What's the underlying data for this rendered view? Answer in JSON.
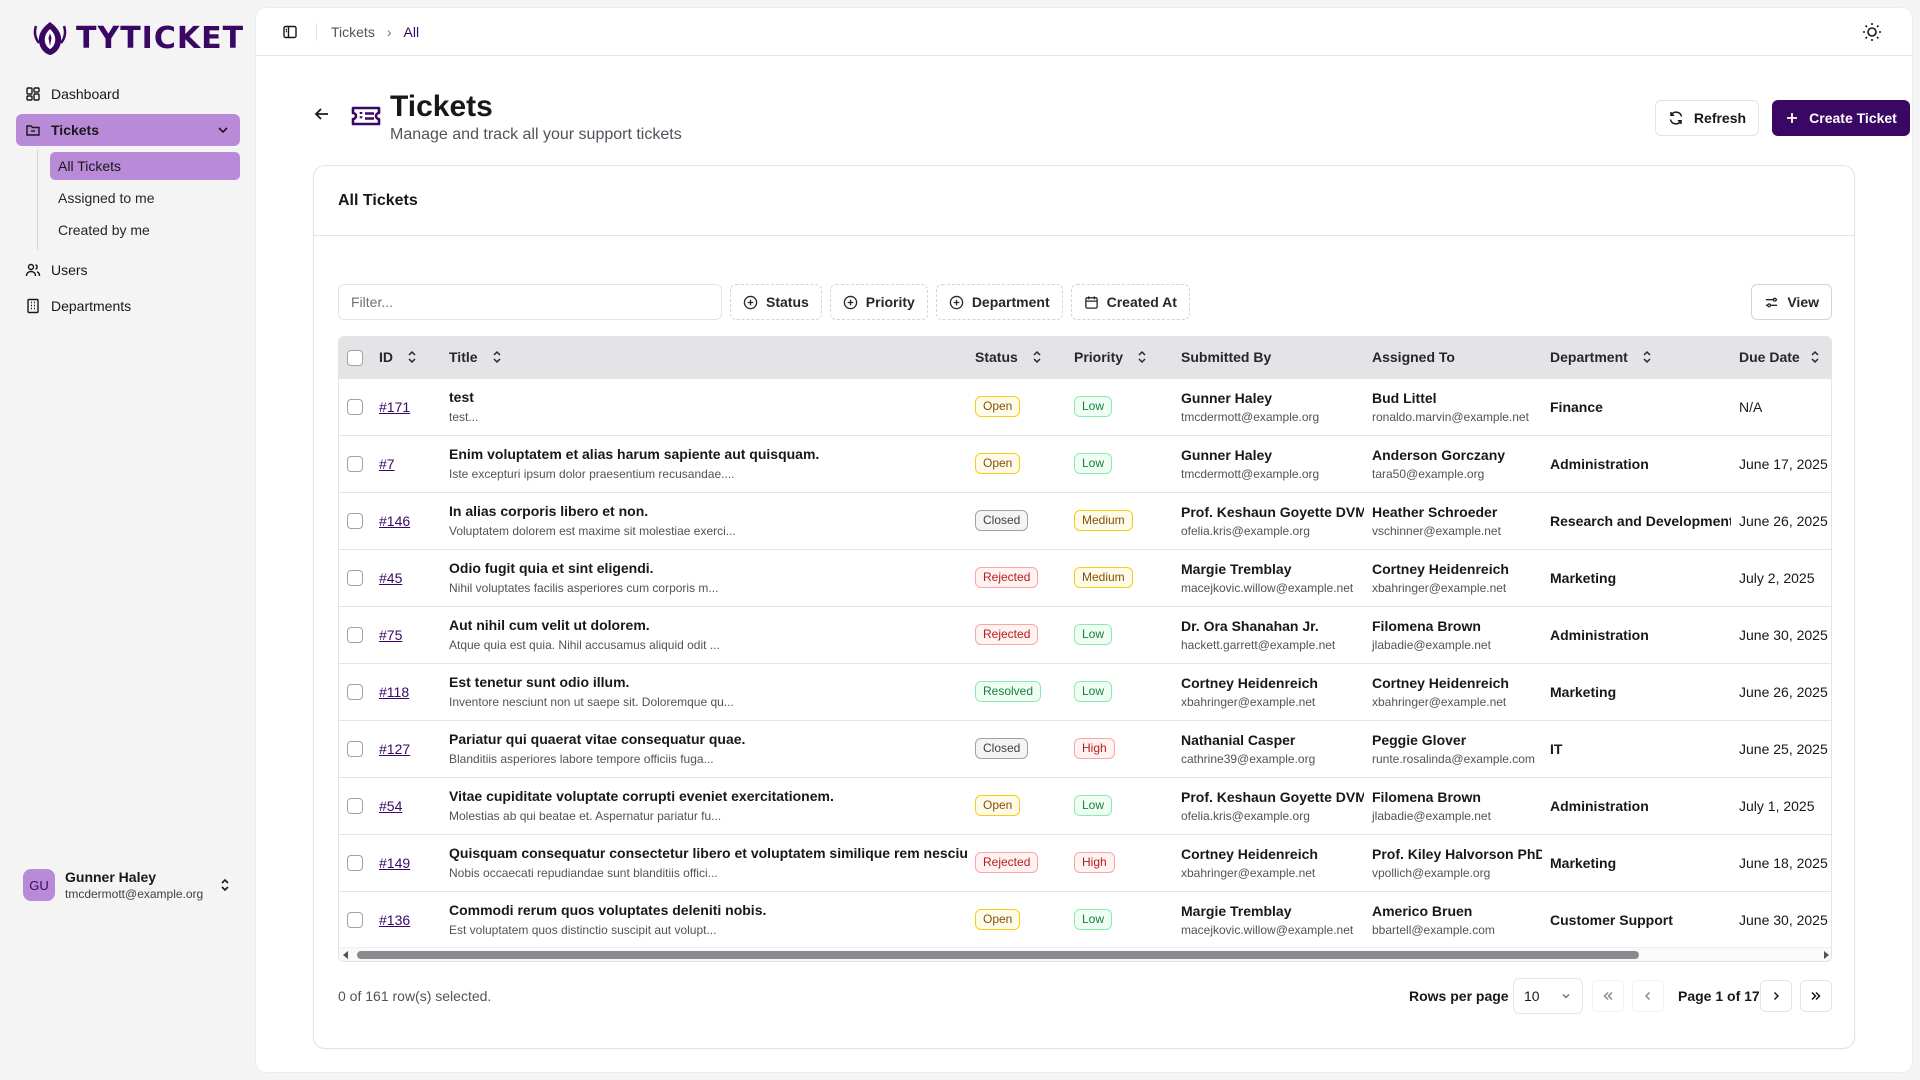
{
  "brand": {
    "name": "TYTICKET",
    "color": "#3b0764"
  },
  "sidebar": {
    "items": [
      {
        "label": "Dashboard",
        "icon": "dashboard-icon"
      },
      {
        "label": "Tickets",
        "icon": "ticket-folder-icon"
      },
      {
        "label": "Users",
        "icon": "users-icon"
      },
      {
        "label": "Departments",
        "icon": "building-icon"
      }
    ],
    "tickets_sub": [
      {
        "label": "All Tickets"
      },
      {
        "label": "Assigned to me"
      },
      {
        "label": "Created by me"
      }
    ],
    "user": {
      "initials": "GU",
      "name": "Gunner Haley",
      "email": "tmcdermott@example.org"
    }
  },
  "breadcrumb": {
    "root": "Tickets",
    "current": "All"
  },
  "header": {
    "title": "Tickets",
    "subtitle": "Manage and track all your support tickets",
    "refresh_label": "Refresh",
    "create_label": "Create Ticket"
  },
  "card": {
    "title": "All Tickets"
  },
  "toolbar": {
    "filter_placeholder": "Filter...",
    "status": "Status",
    "priority": "Priority",
    "department": "Department",
    "created_at": "Created At",
    "view": "View"
  },
  "table": {
    "columns": {
      "id": "ID",
      "title": "Title",
      "status": "Status",
      "priority": "Priority",
      "submitted_by": "Submitted By",
      "assigned_to": "Assigned To",
      "department": "Department",
      "due_date": "Due Date"
    },
    "rows": [
      {
        "id": "#171",
        "title": "test",
        "desc": "test...",
        "status": "Open",
        "priority": "Low",
        "sub_name": "Gunner Haley",
        "sub_email": "tmcdermott@example.org",
        "asg_name": "Bud Littel",
        "asg_email": "ronaldo.marvin@example.net",
        "dept": "Finance",
        "due": "N/A"
      },
      {
        "id": "#7",
        "title": "Enim voluptatem et alias harum sapiente aut quisquam.",
        "desc": "Iste excepturi ipsum dolor praesentium recusandae....",
        "status": "Open",
        "priority": "Low",
        "sub_name": "Gunner Haley",
        "sub_email": "tmcdermott@example.org",
        "asg_name": "Anderson Gorczany",
        "asg_email": "tara50@example.org",
        "dept": "Administration",
        "due": "June 17, 2025"
      },
      {
        "id": "#146",
        "title": "In alias corporis libero et non.",
        "desc": "Voluptatem dolorem est maxime sit molestiae exerci...",
        "status": "Closed",
        "priority": "Medium",
        "sub_name": "Prof. Keshaun Goyette DVM",
        "sub_email": "ofelia.kris@example.org",
        "asg_name": "Heather Schroeder",
        "asg_email": "vschinner@example.net",
        "dept": "Research and Development",
        "due": "June 26, 2025"
      },
      {
        "id": "#45",
        "title": "Odio fugit quia et sint eligendi.",
        "desc": "Nihil voluptates facilis asperiores cum corporis m...",
        "status": "Rejected",
        "priority": "Medium",
        "sub_name": "Margie Tremblay",
        "sub_email": "macejkovic.willow@example.net",
        "asg_name": "Cortney Heidenreich",
        "asg_email": "xbahringer@example.net",
        "dept": "Marketing",
        "due": "July 2, 2025"
      },
      {
        "id": "#75",
        "title": "Aut nihil cum velit ut dolorem.",
        "desc": "Atque quia est quia. Nihil accusamus aliquid odit ...",
        "status": "Rejected",
        "priority": "Low",
        "sub_name": "Dr. Ora Shanahan Jr.",
        "sub_email": "hackett.garrett@example.net",
        "asg_name": "Filomena Brown",
        "asg_email": "jlabadie@example.net",
        "dept": "Administration",
        "due": "June 30, 2025"
      },
      {
        "id": "#118",
        "title": "Est tenetur sunt odio illum.",
        "desc": "Inventore nesciunt non ut saepe sit. Doloremque qu...",
        "status": "Resolved",
        "priority": "Low",
        "sub_name": "Cortney Heidenreich",
        "sub_email": "xbahringer@example.net",
        "asg_name": "Cortney Heidenreich",
        "asg_email": "xbahringer@example.net",
        "dept": "Marketing",
        "due": "June 26, 2025"
      },
      {
        "id": "#127",
        "title": "Pariatur qui quaerat vitae consequatur quae.",
        "desc": "Blanditiis asperiores labore tempore officiis fuga...",
        "status": "Closed",
        "priority": "High",
        "sub_name": "Nathanial Casper",
        "sub_email": "cathrine39@example.org",
        "asg_name": "Peggie Glover",
        "asg_email": "runte.rosalinda@example.com",
        "dept": "IT",
        "due": "June 25, 2025"
      },
      {
        "id": "#54",
        "title": "Vitae cupiditate voluptate corrupti eveniet exercitationem.",
        "desc": "Molestias ab qui beatae et. Aspernatur pariatur fu...",
        "status": "Open",
        "priority": "Low",
        "sub_name": "Prof. Keshaun Goyette DVM",
        "sub_email": "ofelia.kris@example.org",
        "asg_name": "Filomena Brown",
        "asg_email": "jlabadie@example.net",
        "dept": "Administration",
        "due": "July 1, 2025"
      },
      {
        "id": "#149",
        "title": "Quisquam consequatur consectetur libero et voluptatem similique rem nesciunt.",
        "desc": "Nobis occaecati repudiandae sunt blanditiis offici...",
        "status": "Rejected",
        "priority": "High",
        "sub_name": "Cortney Heidenreich",
        "sub_email": "xbahringer@example.net",
        "asg_name": "Prof. Kiley Halvorson PhD",
        "asg_email": "vpollich@example.org",
        "dept": "Marketing",
        "due": "June 18, 2025"
      },
      {
        "id": "#136",
        "title": "Commodi rerum quos voluptates deleniti nobis.",
        "desc": "Est voluptatem quos distinctio suscipit aut volupt...",
        "status": "Open",
        "priority": "Low",
        "sub_name": "Margie Tremblay",
        "sub_email": "macejkovic.willow@example.net",
        "asg_name": "Americo Bruen",
        "asg_email": "bbartell@example.com",
        "dept": "Customer Support",
        "due": "June 30, 2025"
      }
    ]
  },
  "footer": {
    "selected_text": "0 of 161 row(s) selected.",
    "rows_per_page_label": "Rows per page",
    "rows_per_page_value": "10",
    "page_text": "Page 1 of 17"
  }
}
